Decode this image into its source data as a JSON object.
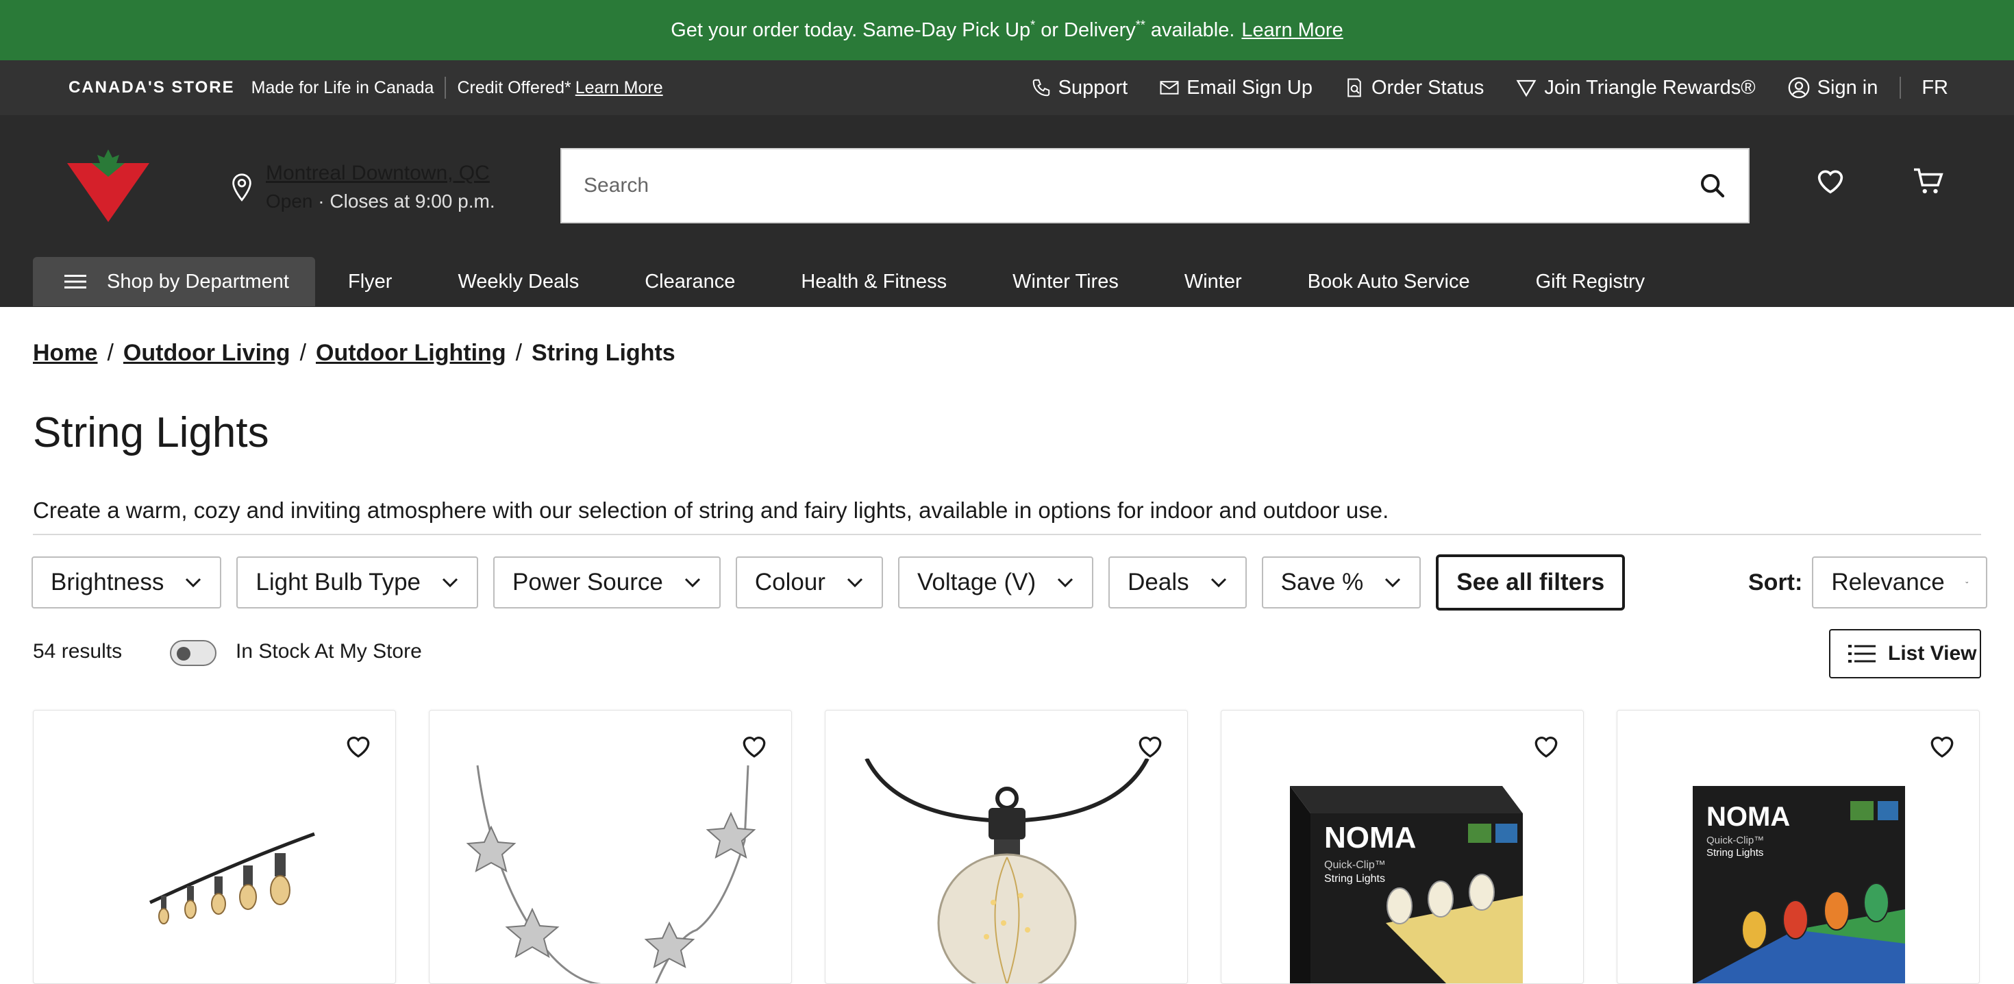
{
  "promo": {
    "text_before": "Get your order today. Same-Day Pick Up",
    "sup1": "*",
    "text_mid": " or Delivery",
    "sup2": "**",
    "text_after": " available.",
    "link": "Learn More"
  },
  "util": {
    "logo_text": "CANADA'S STORE",
    "tagline": "Made for Life in Canada",
    "credit": "Credit Offered*",
    "credit_link": "Learn More",
    "right": {
      "support": "Support",
      "email": "Email Sign Up",
      "order": "Order Status",
      "rewards": "Join Triangle Rewards®",
      "signin": "Sign in",
      "lang": "FR"
    }
  },
  "store": {
    "name": "Montreal Downtown, QC",
    "status": "Open",
    "hours": "·  Closes at 9:00 p.m."
  },
  "search": {
    "placeholder": "Search"
  },
  "nav": {
    "dept": "Shop by Department",
    "items": [
      "Flyer",
      "Weekly Deals",
      "Clearance",
      "Health & Fitness",
      "Winter Tires",
      "Winter",
      "Book Auto Service",
      "Gift Registry"
    ]
  },
  "breadcrumb": [
    "Home",
    "Outdoor Living",
    "Outdoor Lighting",
    "String Lights"
  ],
  "page": {
    "title": "String Lights",
    "description": "Create a warm, cozy and inviting atmosphere with our selection of string and fairy lights, available in options for indoor and outdoor use."
  },
  "filters": [
    "Brightness",
    "Light Bulb Type",
    "Power Source",
    "Colour",
    "Voltage (V)",
    "Deals",
    "Save %"
  ],
  "see_all": "See all filters",
  "sort": {
    "label": "Sort:",
    "value": "Relevance"
  },
  "results": {
    "count": "54 results",
    "instock": "In Stock At My Store",
    "instock_on": false
  },
  "list_view": "List View",
  "products": [
    {
      "image": "edison-string-lights"
    },
    {
      "image": "star-fairy-lights"
    },
    {
      "image": "globe-bulb-lights"
    },
    {
      "image": "noma-quick-clip-white-box",
      "brand": "NOMA",
      "line": "Quick-Clip™",
      "name": "String Lights"
    },
    {
      "image": "noma-quick-clip-multicolour-box",
      "brand": "NOMA",
      "line": "Quick-Clip™",
      "name": "String Lights"
    }
  ],
  "colors": {
    "promo_bg": "#2a7a38",
    "header_bg": "#2b2b2b",
    "util_bg": "#333333",
    "brand_red": "#d5202a"
  }
}
